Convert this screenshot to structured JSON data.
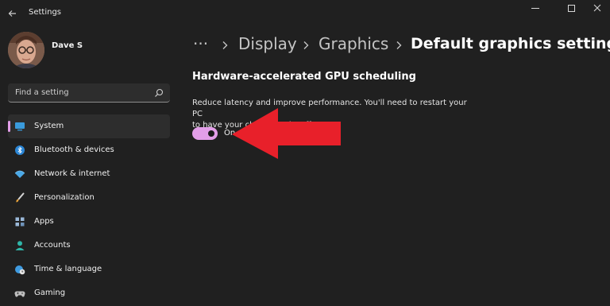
{
  "window": {
    "title": "Settings"
  },
  "user": {
    "name": "Dave S"
  },
  "search": {
    "placeholder": "Find a setting"
  },
  "sidebar": {
    "items": [
      {
        "label": "System",
        "icon": "monitor-icon",
        "active": true
      },
      {
        "label": "Bluetooth & devices",
        "icon": "bluetooth-icon"
      },
      {
        "label": "Network & internet",
        "icon": "wifi-icon"
      },
      {
        "label": "Personalization",
        "icon": "brush-icon"
      },
      {
        "label": "Apps",
        "icon": "apps-grid-icon"
      },
      {
        "label": "Accounts",
        "icon": "person-icon"
      },
      {
        "label": "Time & language",
        "icon": "globe-clock-icon"
      },
      {
        "label": "Gaming",
        "icon": "gamepad-icon"
      }
    ]
  },
  "breadcrumb": {
    "ellipsis": "···",
    "items": [
      "Display",
      "Graphics"
    ],
    "current": "Default graphics settings"
  },
  "main": {
    "section_title": "Hardware-accelerated GPU scheduling",
    "description_line1": "Reduce latency and improve performance. You'll need to restart your PC",
    "description_line2": "to have your changes take effect.",
    "toggle_state": "On",
    "toggle_on": true
  },
  "colors": {
    "background": "#202020",
    "accent": "#e29ee8",
    "annotation_arrow": "#e8202a"
  }
}
